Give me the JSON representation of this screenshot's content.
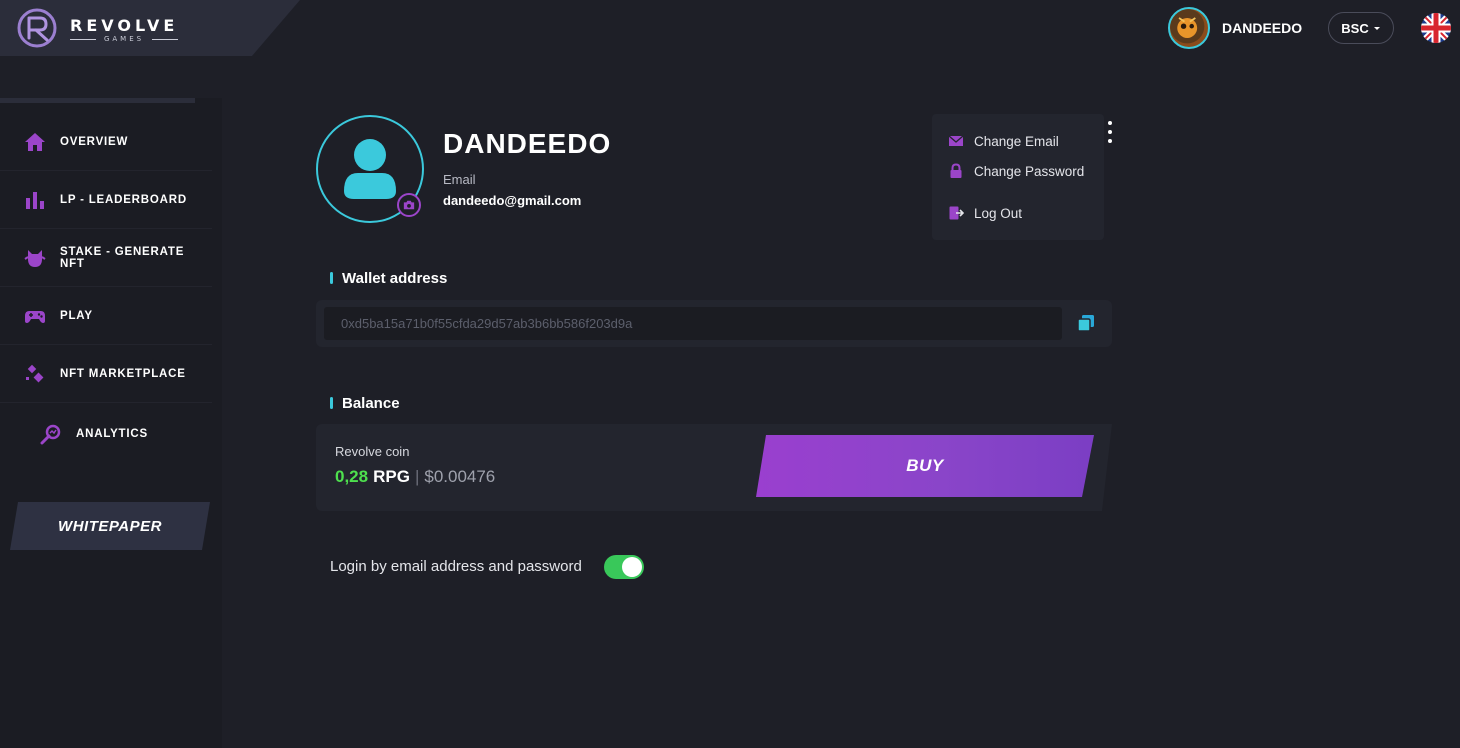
{
  "header": {
    "brand_name": "REVOLVE",
    "brand_sub": "GAMES",
    "username": "DANDEEDO",
    "network": "BSC",
    "language": "English"
  },
  "sidebar": {
    "items": [
      {
        "label": "OVERVIEW",
        "icon": "home-icon"
      },
      {
        "label": "LP - LEADERBOARD",
        "icon": "bar-chart-icon"
      },
      {
        "label": "STAKE - GENERATE NFT",
        "icon": "monster-icon"
      },
      {
        "label": "PLAY",
        "icon": "gamepad-icon"
      },
      {
        "label": "NFT MARKETPLACE",
        "icon": "nft-icon"
      },
      {
        "label": "ANALYTICS",
        "icon": "analytics-icon"
      }
    ],
    "whitepaper": "WHITEPAPER"
  },
  "profile": {
    "name": "DANDEEDO",
    "email_label": "Email",
    "email": "dandeedo@gmail.com"
  },
  "account_menu": {
    "change_email": "Change Email",
    "change_password": "Change Password",
    "log_out": "Log Out"
  },
  "wallet": {
    "title": "Wallet address",
    "address": "0xd5ba15a71b0f55cfda29d57ab3b6bb586f203d9a"
  },
  "balance": {
    "title": "Balance",
    "coin_label": "Revolve coin",
    "amount": "0,28",
    "unit": "RPG",
    "separator": "|",
    "usd": "$0.00476",
    "buy_label": "BUY"
  },
  "settings": {
    "login_label": "Login by email address and password",
    "login_enabled": true
  },
  "colors": {
    "accent_cyan": "#3bc9dc",
    "accent_purple": "#9a3fcf",
    "positive_green": "#4ee04e",
    "toggle_on": "#39c85a",
    "background": "#1e1f27"
  }
}
